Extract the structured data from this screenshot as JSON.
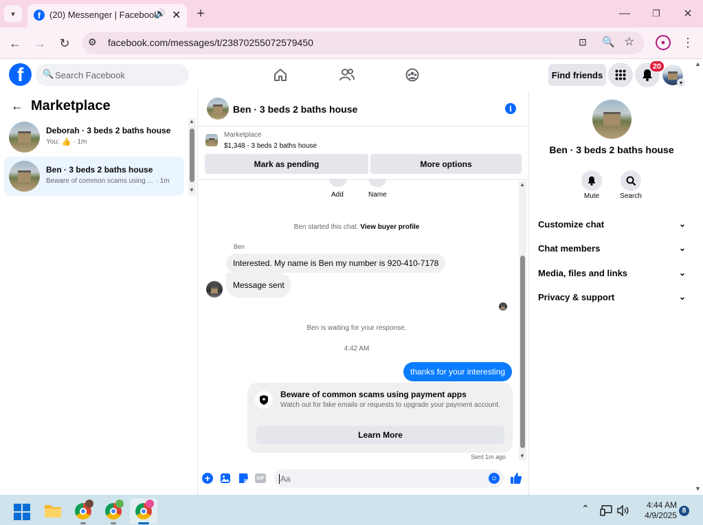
{
  "browser": {
    "tab_title": "(20) Messenger | Facebook",
    "url": "facebook.com/messages/t/23870255072579450"
  },
  "fb_header": {
    "search_placeholder": "Search Facebook",
    "find_friends": "Find friends",
    "notif_count": "20"
  },
  "left_panel": {
    "title": "Marketplace",
    "chats": [
      {
        "name": "Deborah · 3 beds 2 baths house",
        "preview": "You:",
        "time": "· 1m"
      },
      {
        "name": "Ben · 3 beds 2 baths house",
        "preview": "Beware of common scams using ...",
        "time": "· 1m"
      }
    ]
  },
  "conversation": {
    "title": "Ben · 3 beds 2 baths house",
    "listing_source": "Marketplace",
    "listing": "$1,348 - 3 beds 2 baths house",
    "mark_pending": "Mark as pending",
    "more_options": "More options",
    "add_label": "Add",
    "name_label": "Name",
    "started_text": "Ben started this chat.",
    "view_buyer": "View buyer profile",
    "sender_name": "Ben",
    "msg1": "Interested.  My name is Ben my number is 920-410-7178",
    "msg2": "Message sent",
    "waiting": "Ben is waiting for your response.",
    "timestamp": "4:42 AM",
    "my_msg": "thanks for your interesting",
    "scam_title": "Beware of common scams using payment apps",
    "scam_body": "Watch out for fake emails or requests to upgrade your payment account.",
    "learn_more": "Learn More",
    "sent_status": "Sent 1m ago",
    "composer_placeholder": "Aa",
    "gif_label": "GIF"
  },
  "right_panel": {
    "title": "Ben · 3 beds 2 baths house",
    "mute": "Mute",
    "search": "Search",
    "menu": [
      "Customize chat",
      "Chat members",
      "Media, files and links",
      "Privacy & support"
    ]
  },
  "taskbar": {
    "time": "4:44 AM",
    "date": "4/9/2025",
    "notif": "8"
  },
  "colors": {
    "fb_blue": "#0866ff",
    "my_bubble": "#0a7cff",
    "badge_red": "#e41e3f"
  }
}
